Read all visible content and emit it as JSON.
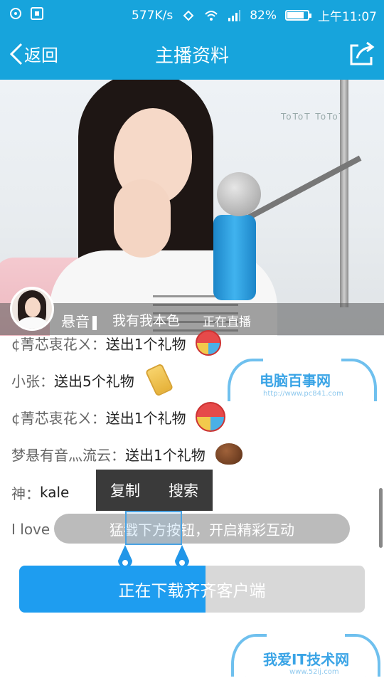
{
  "status_bar": {
    "network_speed": "577K/s",
    "battery_percent": "82%",
    "battery_level": 0.82,
    "time": "上午11:07"
  },
  "nav": {
    "back_label": "返回",
    "title": "主播资料"
  },
  "hero": {
    "streamer_name": "悬音",
    "motto": "我有我本色",
    "live_status": "正在直播",
    "sign_text": "ToToT ToToT"
  },
  "chat": [
    {
      "user": "¢菁芯衷花ㄨ",
      "colon": "：",
      "text": "送出1个礼物",
      "gift": "ball-gift-icon"
    },
    {
      "user": "小张",
      "colon": "：",
      "text": "送出5个礼物",
      "gift": "phone-gift-icon"
    },
    {
      "user": "¢菁芯衷花ㄨ",
      "colon": "：",
      "text": "送出1个礼物",
      "gift": "ball-gift-icon"
    },
    {
      "user": "梦悬有音灬流云",
      "colon": "：",
      "text": "送出1个礼物",
      "gift": "chocolate-gift-icon"
    },
    {
      "user": "神",
      "colon": "：",
      "text": "kale"
    },
    {
      "user": "I love",
      "colon": "",
      "text": ""
    }
  ],
  "context_menu": {
    "copy_label": "复制",
    "search_label": "搜索"
  },
  "hint_text": "猛戳下方按钮，开启精彩互动",
  "download": {
    "label": "正在下载齐齐客户端",
    "progress": 0.54
  },
  "watermarks": {
    "top_title": "电脑百事网",
    "top_url": "http://www.pc841.com",
    "bottom_title": "我爱IT技术网",
    "bottom_url": "www.52ij.com"
  },
  "colors": {
    "primary": "#17a4dc",
    "button_blue": "#1e9df0"
  }
}
